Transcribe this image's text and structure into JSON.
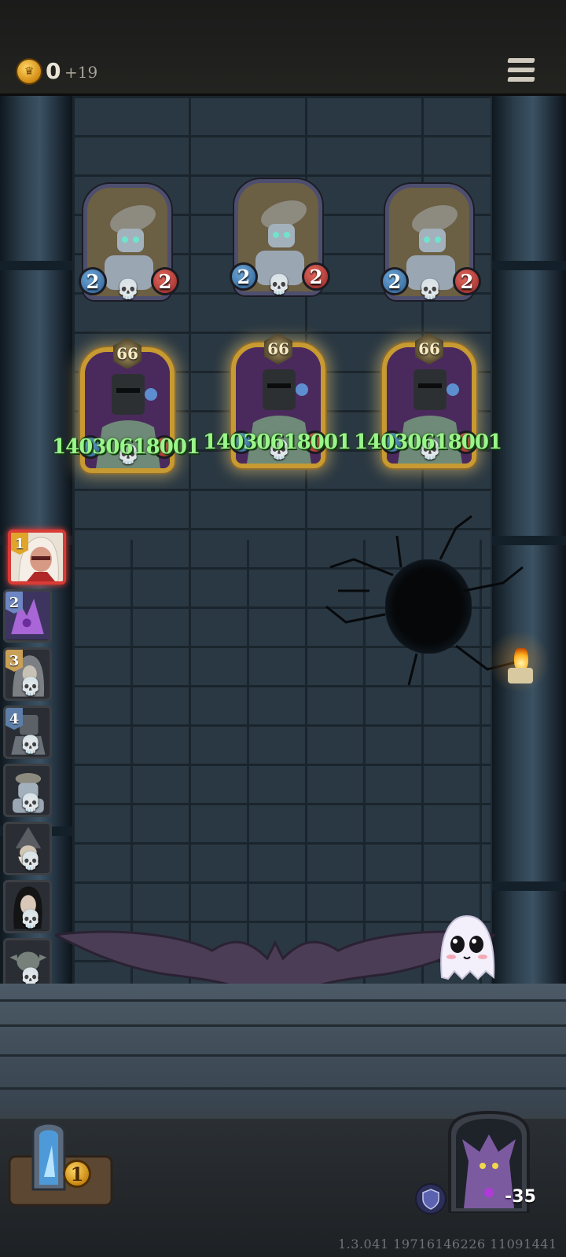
{
  "top_bar": {
    "gold": "0",
    "gold_delta": "+19",
    "menu_icon": "hamburger-menu-icon"
  },
  "enemies_back_row": [
    {
      "attack": "2",
      "health": "2",
      "icon": "robot-bell-icon"
    },
    {
      "attack": "2",
      "health": "2",
      "icon": "robot-bell-icon"
    },
    {
      "attack": "2",
      "health": "2",
      "icon": "robot-bell-icon"
    }
  ],
  "enemies_front_row": [
    {
      "level": "66",
      "damage_text": "14030618001",
      "icon": "knight-helmet-icon"
    },
    {
      "level": "66",
      "damage_text": "14030618001",
      "icon": "knight-helmet-icon"
    },
    {
      "level": "66",
      "damage_text": "14030618001",
      "icon": "knight-helmet-icon"
    }
  ],
  "turn_queue": [
    {
      "number": "1",
      "color": "#e0a52b",
      "portrait": "hooded-hero-icon",
      "active": true
    },
    {
      "number": "2",
      "color": "#6e86c2",
      "portrait": "purple-dragon-icon"
    },
    {
      "number": "3",
      "color": "#c9a056",
      "portrait": "grey-hood-icon"
    },
    {
      "number": "4",
      "color": "#5c7ea8",
      "portrait": "armored-knight-icon"
    },
    {
      "number": "",
      "color": "",
      "portrait": "robot-bell-icon"
    },
    {
      "number": "",
      "color": "",
      "portrait": "old-wizard-icon"
    },
    {
      "number": "",
      "color": "",
      "portrait": "dark-hair-woman-icon"
    },
    {
      "number": "",
      "color": "",
      "portrait": "goblin-icon"
    }
  ],
  "skull_symbol": "💀",
  "deck": {
    "count": "1",
    "icon": "spell-book-icon"
  },
  "hero": {
    "health": "-35",
    "icon": "dragon-hero-icon",
    "shield_icon": "shield-icon"
  },
  "version": "1.3.041 19716146226 11091441",
  "colors": {
    "wall": "#2a3843",
    "gold_frame": "#c79a32",
    "heal_text": "#9bf58b",
    "attack_badge": "#2c5e92",
    "health_badge": "#952626"
  }
}
